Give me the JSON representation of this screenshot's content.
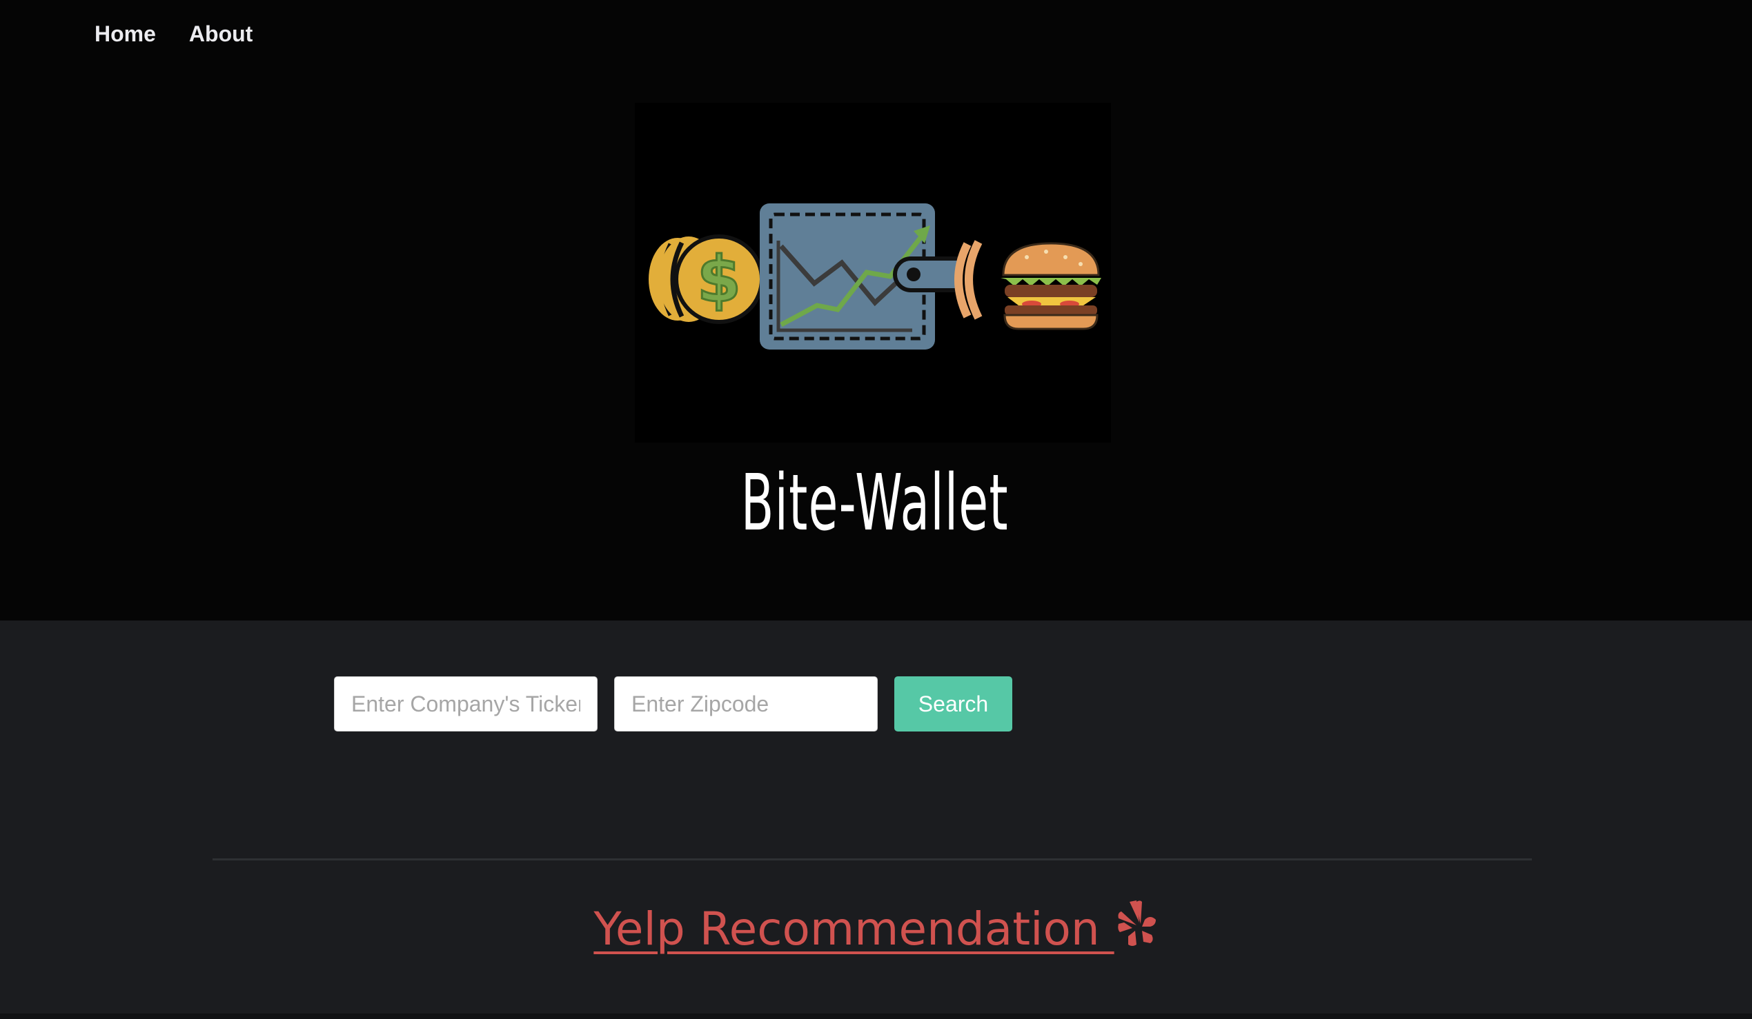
{
  "nav": {
    "items": [
      {
        "label": "Home"
      },
      {
        "label": "About"
      }
    ]
  },
  "brand": {
    "title": "Bite-Wallet",
    "logo_icons": [
      "coins-icon",
      "dollar-icon",
      "wallet-chart-icon",
      "burger-icon"
    ]
  },
  "search": {
    "ticker_placeholder": "Enter Company's Ticker",
    "zipcode_placeholder": "Enter Zipcode",
    "button_label": "Search"
  },
  "yelp": {
    "label": "Yelp Recommendation ",
    "icon": "yelp-icon"
  },
  "colors": {
    "hero_bg": "#050505",
    "page_bg": "#1b1c1f",
    "accent_button": "#56c8a6",
    "yelp_red": "#d0524f",
    "nav_text": "#ececf0"
  }
}
